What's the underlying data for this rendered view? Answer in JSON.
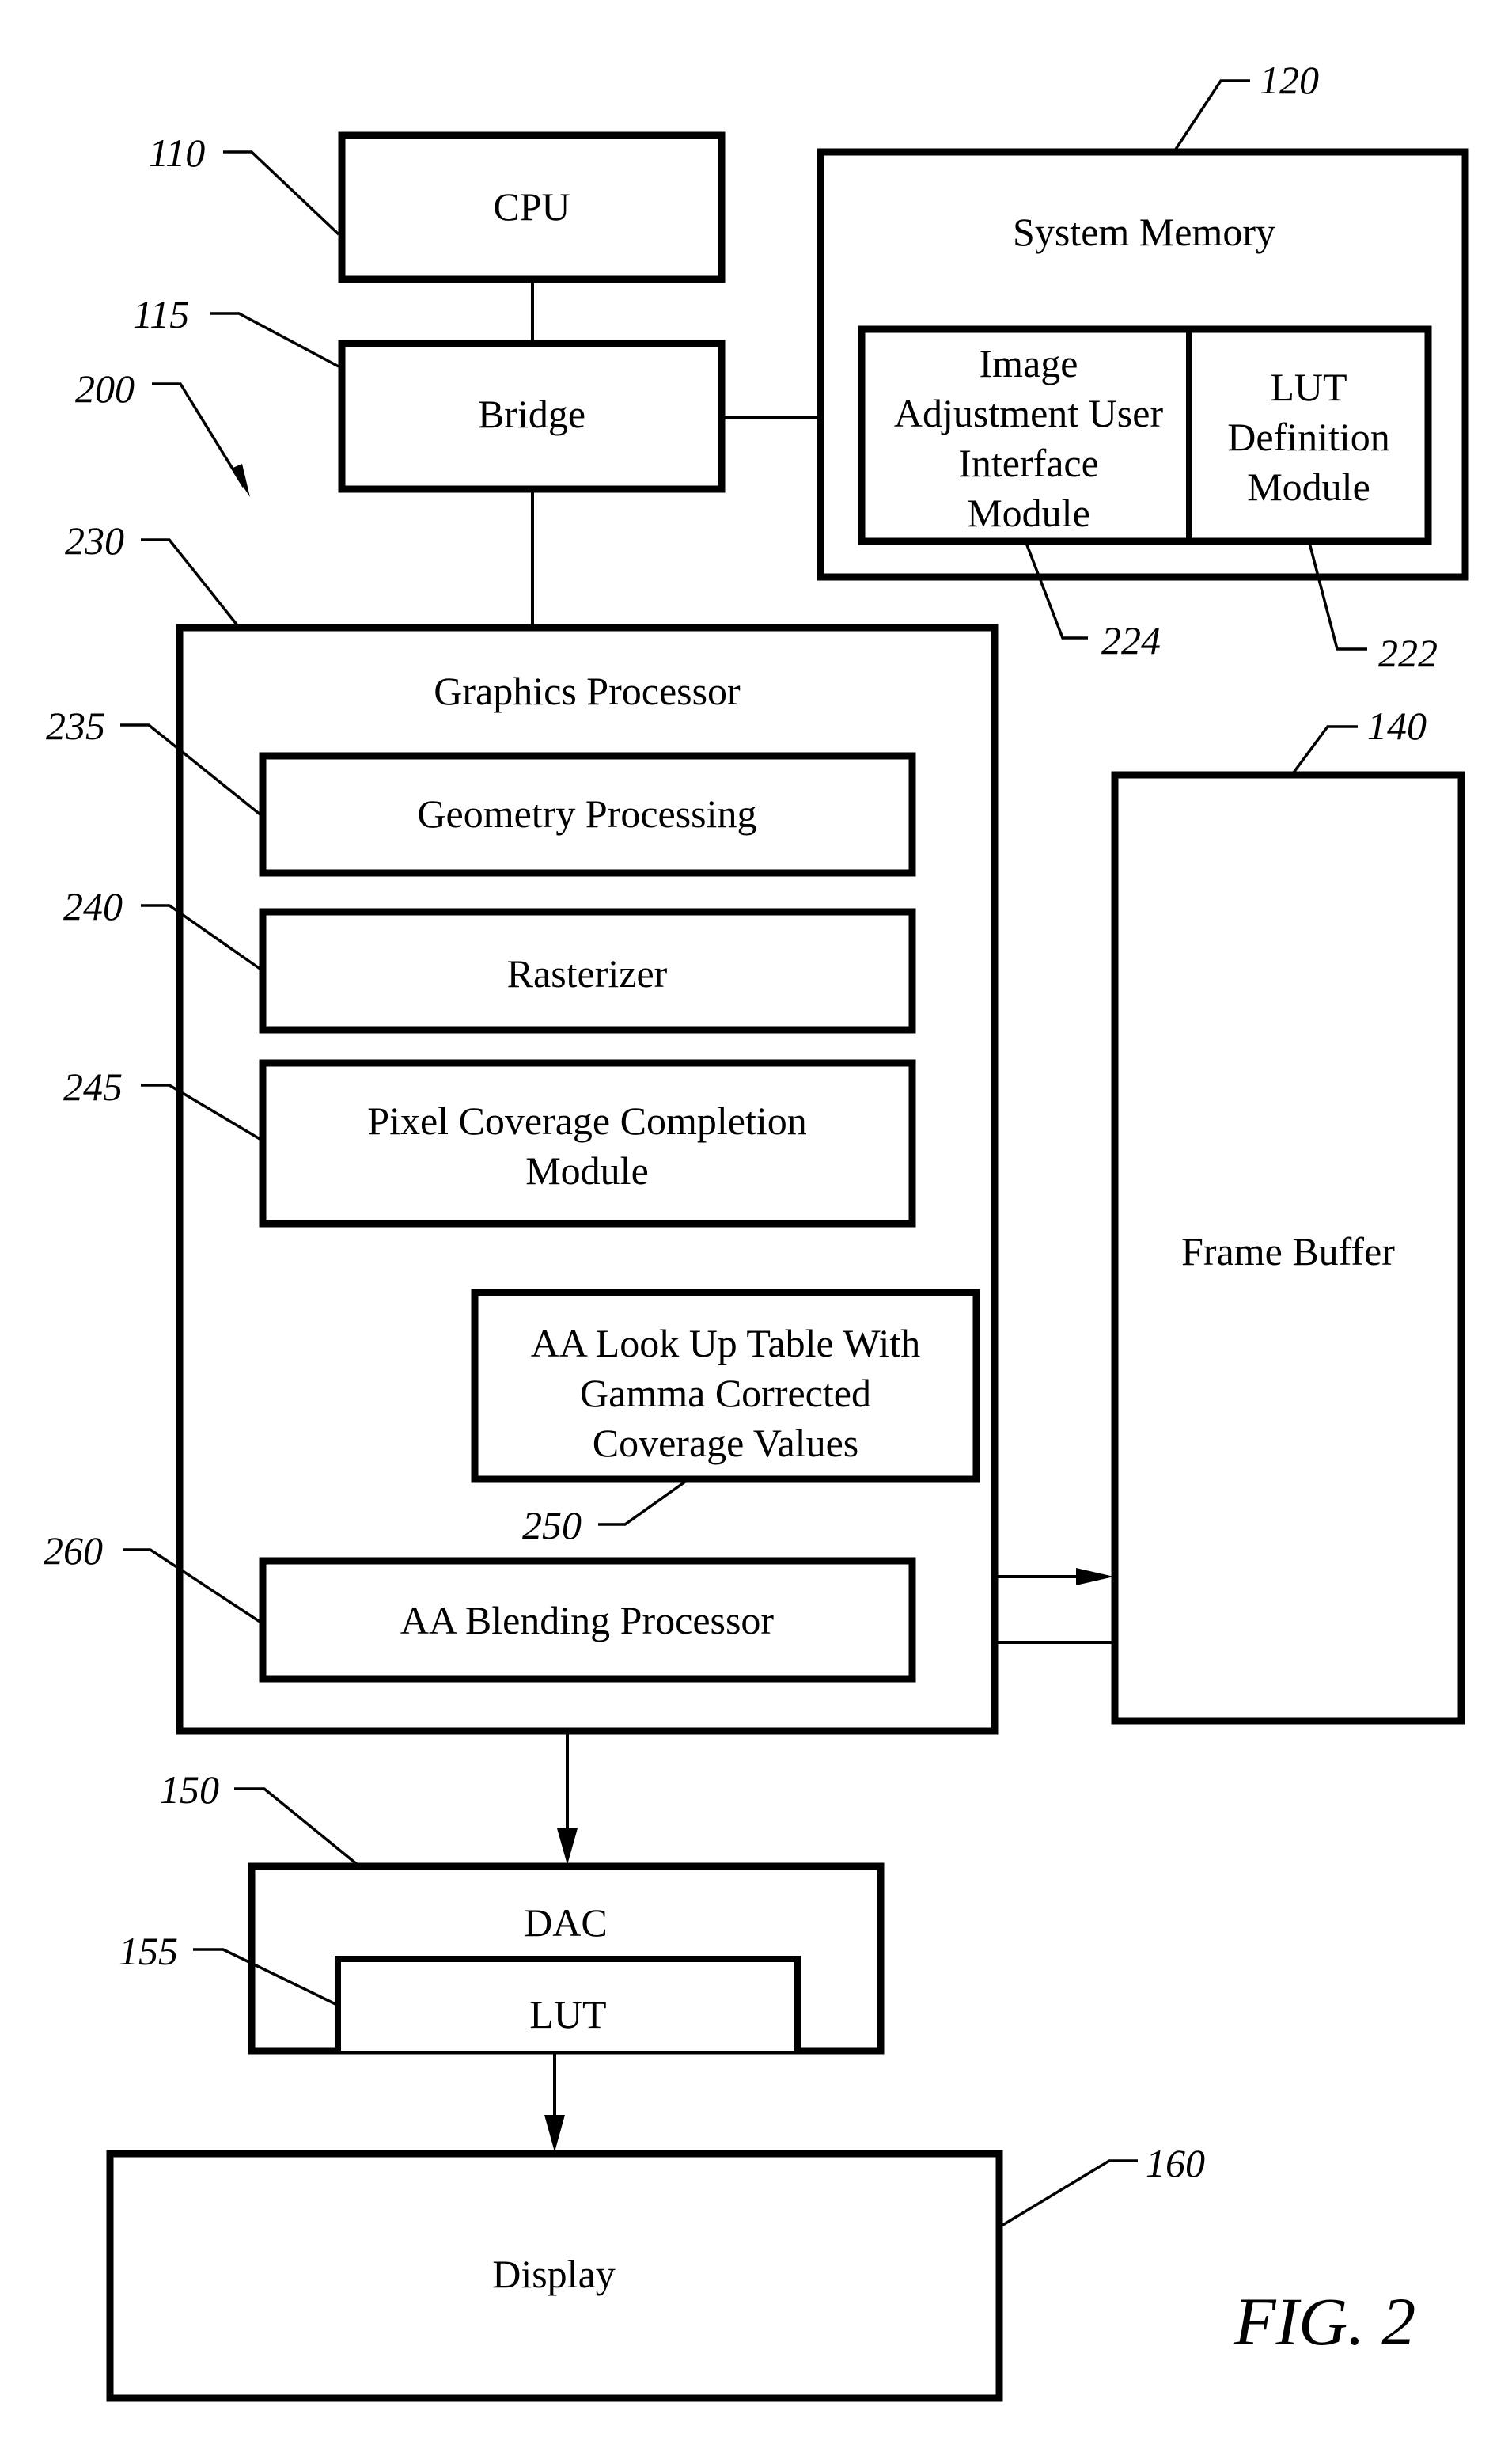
{
  "figure": {
    "caption": "FIG. 2",
    "system_ref": "200"
  },
  "blocks": {
    "cpu": {
      "label": "CPU",
      "ref": "110"
    },
    "bridge": {
      "label": "Bridge",
      "ref": "115"
    },
    "system_memory": {
      "label": "System Memory",
      "ref": "120"
    },
    "image_adjustment_ui_module": {
      "lines": [
        "Image",
        "Adjustment User",
        "Interface",
        "Module"
      ],
      "ref": "224"
    },
    "lut_definition_module": {
      "lines": [
        "LUT",
        "Definition",
        "Module"
      ],
      "ref": "222"
    },
    "graphics_processor": {
      "label": "Graphics Processor",
      "ref": "230"
    },
    "geometry_processing": {
      "label": "Geometry Processing",
      "ref": "235"
    },
    "rasterizer": {
      "label": "Rasterizer",
      "ref": "240"
    },
    "pixel_coverage_completion": {
      "lines": [
        "Pixel Coverage Completion",
        "Module"
      ],
      "ref": "245"
    },
    "aa_lookup_table": {
      "lines": [
        "AA Look Up Table With",
        "Gamma Corrected",
        "Coverage Values"
      ],
      "ref": "250"
    },
    "aa_blending_processor": {
      "label": "AA Blending Processor",
      "ref": "260"
    },
    "frame_buffer": {
      "label": "Frame Buffer",
      "ref": "140"
    },
    "dac": {
      "label": "DAC",
      "ref": "150"
    },
    "dac_lut": {
      "label": "LUT",
      "ref": "155"
    },
    "display": {
      "label": "Display",
      "ref": "160"
    }
  }
}
